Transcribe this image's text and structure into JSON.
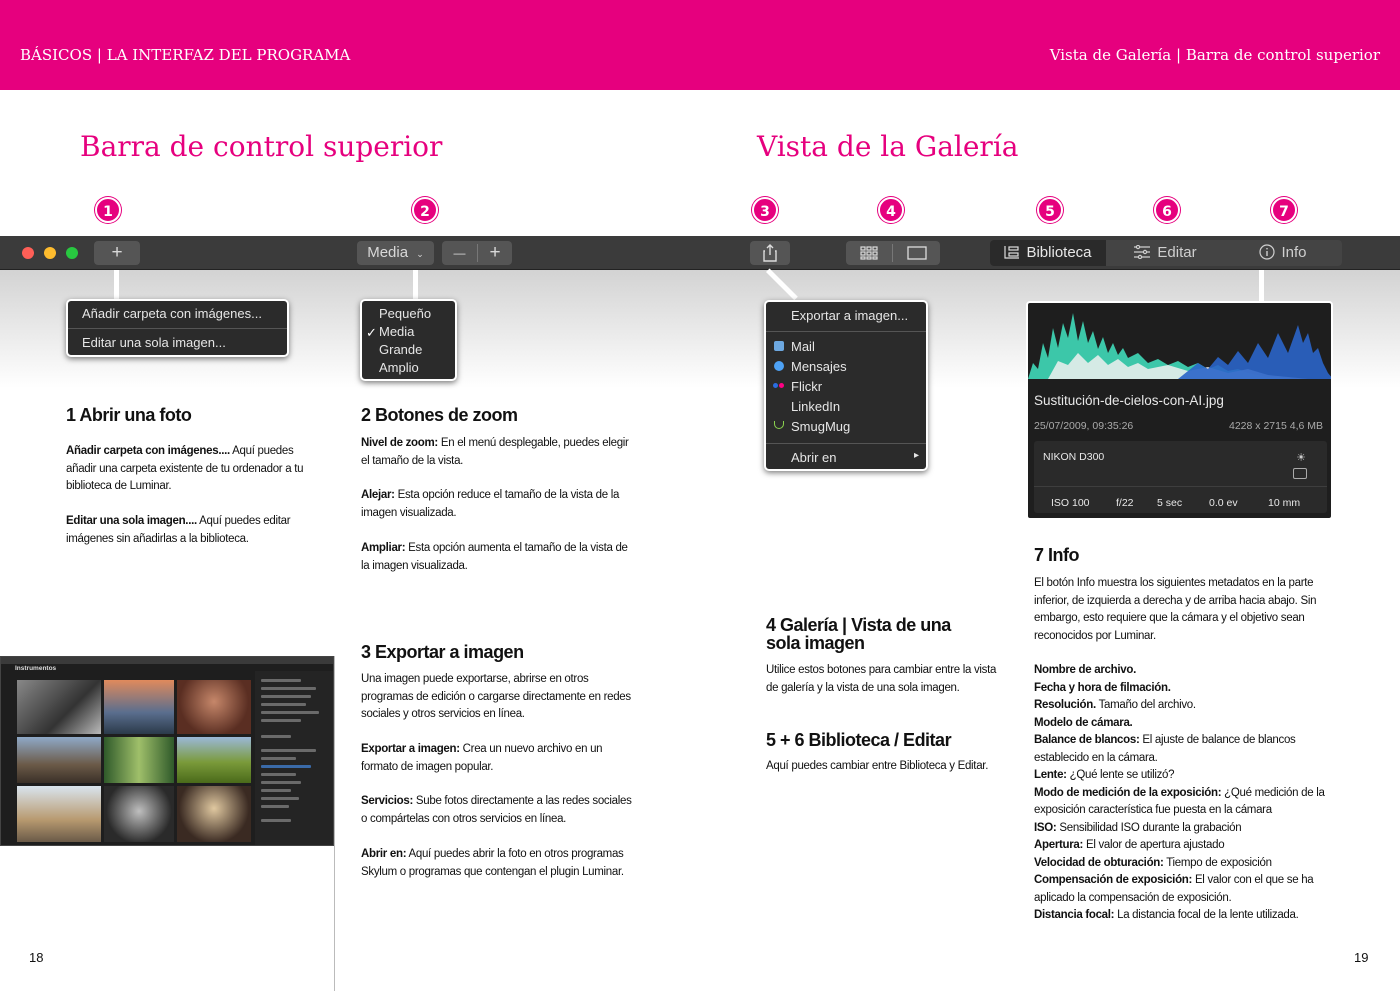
{
  "header": {
    "left": "BÁSICOS | LA INTERFAZ DEL PROGRAMA",
    "right": "Vista de Galería | Barra de control superior"
  },
  "titles": {
    "left": "Barra de control superior",
    "right": "Vista de la Galería"
  },
  "badges": [
    "1",
    "2",
    "3",
    "4",
    "5",
    "6",
    "7"
  ],
  "toolbar": {
    "add": "+",
    "zoom_select": "Media",
    "zoom_minus": "—",
    "zoom_plus": "+",
    "biblioteca": "Biblioteca",
    "editar": "Editar",
    "info": "Info",
    "colors": {
      "close": "#ff5f57",
      "min": "#febc2e",
      "max": "#28c840"
    }
  },
  "menu_add": [
    "Añadir carpeta con imágenes...",
    "Editar una sola imagen..."
  ],
  "menu_zoom": {
    "check": "✓",
    "items": [
      "Pequeño",
      "Media",
      "Grande",
      "Amplio"
    ]
  },
  "menu_export": {
    "title": "Exportar a imagen...",
    "items": [
      "Mail",
      "Mensajes",
      "Flickr",
      "LinkedIn",
      "SmugMug"
    ],
    "open_in": "Abrir en",
    "arrow": "▸"
  },
  "info_panel": {
    "filename": "Sustitución-de-cielos-con-AI.jpg",
    "datetime": "25/07/2009, 09:35:26",
    "resolution": "4228 x 2715",
    "filesize": "4,6 MB",
    "camera": "NIKON D300",
    "iso": "ISO 100",
    "aperture": "f/22",
    "shutter": "5 sec",
    "exposure": "0.0 ev",
    "focal": "10 mm"
  },
  "sections": {
    "s1": {
      "title": "1 Abrir una foto",
      "p1_b": "Añadir carpeta con imágenes....",
      "p1": " Aquí puedes añadir una carpeta existente de tu ordenador a tu biblioteca de Luminar.",
      "p2_b": "Editar una sola imagen....",
      "p2": " Aquí puedes editar imágenes sin añadirlas a la biblioteca."
    },
    "s2": {
      "title": "2 Botones de zoom",
      "p1_b": "Nivel de zoom:",
      "p1": " En el menú desplegable, puedes elegir el tamaño de la vista.",
      "p2_b": "Alejar:",
      "p2": " Esta opción reduce el tamaño de la vista de la imagen visualizada.",
      "p3_b": "Ampliar:",
      "p3": " Esta opción aumenta el tamaño de la vista de la imagen visualizada."
    },
    "s3": {
      "title": "3 Exportar a imagen",
      "p1": "Una imagen puede exportarse, abrirse en otros programas de edición o cargarse directamente en redes sociales y otros servicios en línea.",
      "p2_b": "Exportar a imagen:",
      "p2": " Crea un nuevo archivo en un formato de imagen popular.",
      "p3_b": "Servicios:",
      "p3": " Sube fotos directamente a las redes sociales o compártelas con otros servicios en línea.",
      "p4_b": "Abrir en:",
      "p4": " Aquí puedes abrir la foto en otros programas Skylum o programas que contengan el plugin Luminar."
    },
    "s4": {
      "title_a": "4 Galería | Vista de una",
      "title_b": "sola imagen",
      "p1": "Utilice estos botones para cambiar entre la vista de galería y la vista de una sola imagen."
    },
    "s56": {
      "title": "5 + 6 Biblioteca / Editar",
      "p1": "Aquí puedes cambiar entre Biblioteca y Editar."
    },
    "s7": {
      "title": "7 Info",
      "p1": "El botón Info muestra los siguientes metadatos en la parte inferior, de izquierda a derecha y de arriba hacia abajo. Sin embargo, esto requiere que la cámara y el objetivo sean reconocidos por Luminar.",
      "items": [
        {
          "b": "Nombre de archivo.",
          "t": ""
        },
        {
          "b": "Fecha y hora de filmación.",
          "t": ""
        },
        {
          "b": "Resolución.",
          "t": " Tamaño del archivo."
        },
        {
          "b": "Modelo de cámara.",
          "t": ""
        },
        {
          "b": "Balance de blancos:",
          "t": " El ajuste de balance de blancos establecido en la cámara."
        },
        {
          "b": "Lente:",
          "t": " ¿Qué lente se utilizó?"
        },
        {
          "b": "Modo de medición de la exposición:",
          "t": " ¿Qué medición de la exposición característica fue puesta en la cámara"
        },
        {
          "b": "ISO:",
          "t": " Sensibilidad ISO durante la grabación"
        },
        {
          "b": "Apertura:",
          "t": " El valor de apertura ajustado"
        },
        {
          "b": "Velocidad de obturación:",
          "t": " Tiempo de exposición"
        },
        {
          "b": "Compensación de exposición:",
          "t": " El valor con el que se ha aplicado la compensación de exposición."
        },
        {
          "b": "Distancia focal:",
          "t": " La distancia focal de la lente utilizada."
        }
      ]
    }
  },
  "screenshot": {
    "title": "Instrumentos"
  },
  "page_numbers": {
    "left": "18",
    "right": "19"
  }
}
